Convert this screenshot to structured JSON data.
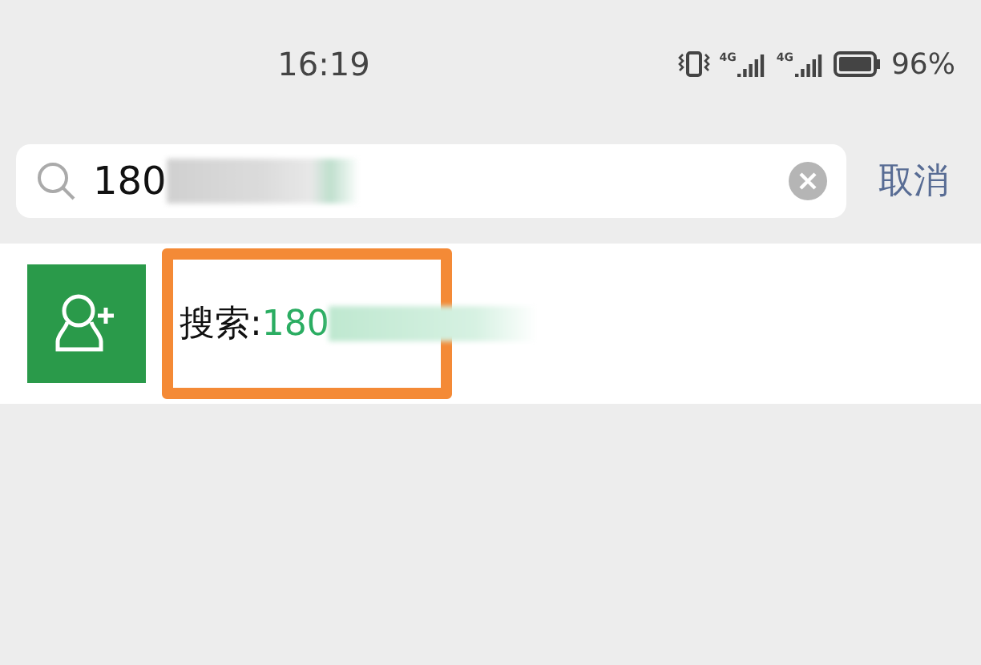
{
  "status_bar": {
    "time": "16:19",
    "networks": [
      "4G",
      "4G"
    ],
    "battery": "96%"
  },
  "search": {
    "value": "180",
    "cancel": "取消"
  },
  "result": {
    "label": "搜索:",
    "query": "180",
    "highlighted": true
  }
}
